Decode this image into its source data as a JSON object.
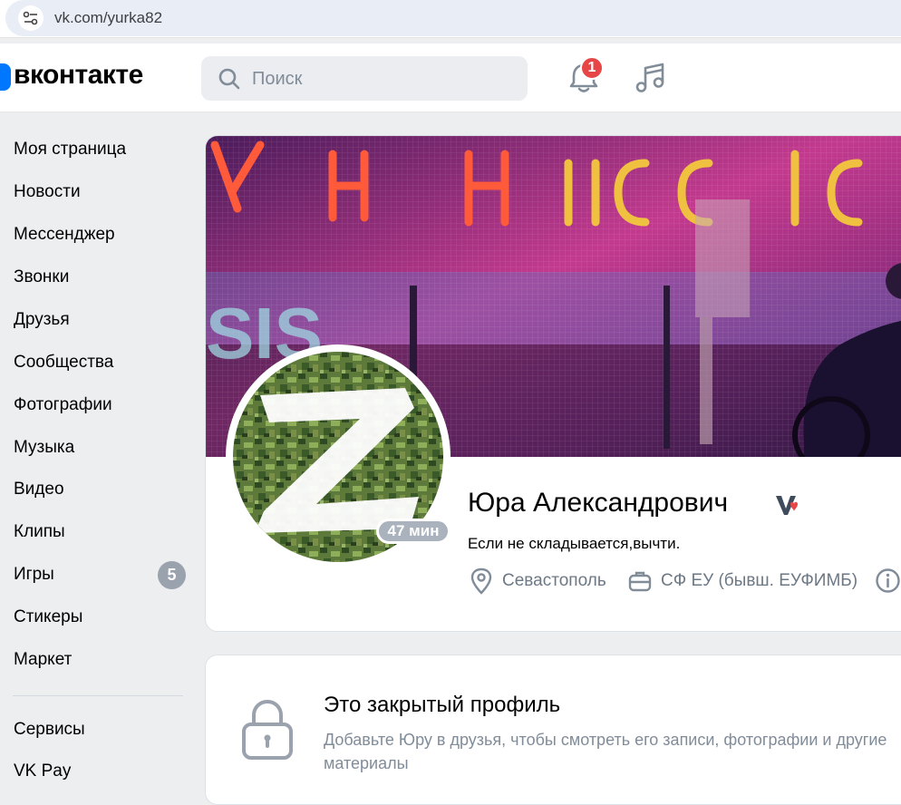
{
  "browser": {
    "url": "vk.com/yurka82"
  },
  "header": {
    "logo_text": "вконтакте",
    "search_placeholder": "Поиск",
    "notifications_count": "1"
  },
  "sidebar": {
    "items": [
      {
        "label": "Моя страница"
      },
      {
        "label": "Новости"
      },
      {
        "label": "Мессенджер"
      },
      {
        "label": "Звонки"
      },
      {
        "label": "Друзья"
      },
      {
        "label": "Сообщества"
      },
      {
        "label": "Фотографии"
      },
      {
        "label": "Музыка"
      },
      {
        "label": "Видео"
      },
      {
        "label": "Клипы"
      },
      {
        "label": "Игры",
        "counter": "5"
      },
      {
        "label": "Стикеры"
      },
      {
        "label": "Маркет"
      }
    ],
    "extra_items": [
      {
        "label": "Сервисы"
      },
      {
        "label": "VK Pay"
      }
    ]
  },
  "profile": {
    "name": "Юра Александрович",
    "last_seen": "47 мин",
    "status": "Если не складывается,вычти.",
    "city": "Севастополь",
    "work": "СФ ЕУ (бывш. ЕУФИМБ)",
    "cover_sign_text": "SIS"
  },
  "closed_profile": {
    "title": "Это закрытый профиль",
    "text": "Добавьте Юру в друзья, чтобы смотреть его записи, фотографии и другие материалы"
  },
  "colors": {
    "accent": "#0077ff",
    "badge": "#e64646",
    "secondary_text": "#818c99",
    "page_bg": "#edeef0"
  },
  "icons": [
    "site-info-icon",
    "search-icon",
    "bell-icon",
    "music-icon",
    "verified-icon",
    "location-icon",
    "briefcase-icon",
    "info-icon",
    "lock-icon"
  ]
}
